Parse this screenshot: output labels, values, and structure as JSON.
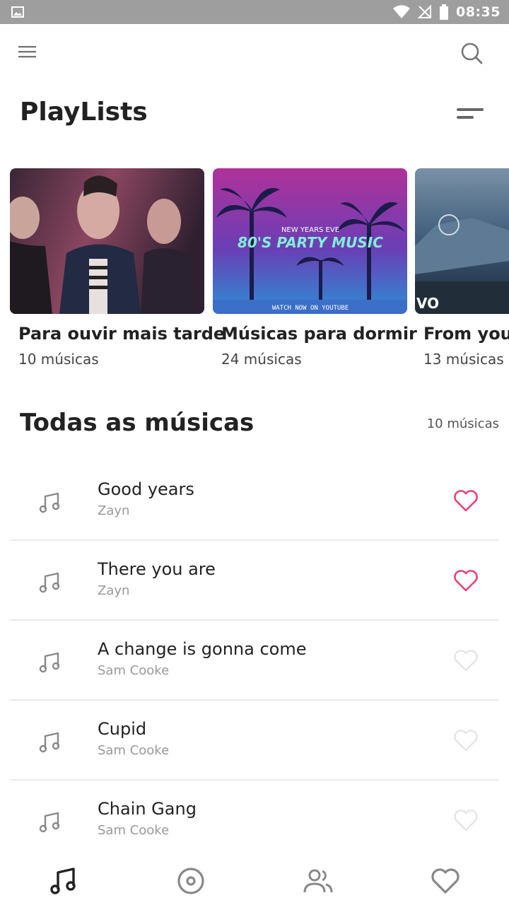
{
  "status_bar": {
    "time": "08:35",
    "icons": [
      "gallery-icon",
      "wifi-icon",
      "no-signal-icon",
      "battery-icon"
    ]
  },
  "app_bar": {
    "icons": [
      "menu-icon",
      "search-icon"
    ]
  },
  "playlists_section": {
    "title": "PlayLists",
    "sort_icon": "sort-icon",
    "items": [
      {
        "title": "Para ouvir mais tarde",
        "count": "10 músicas"
      },
      {
        "title": "Músicas para dormir",
        "count": "24 músicas",
        "art_top": "NEW YEARS EVE",
        "art_main": "80'S PARTY MUSIC",
        "art_bottom": "WATCH NOW ON YOUTUBE"
      },
      {
        "title": "From youtube",
        "count": "13 músicas",
        "art_badge": "VO"
      }
    ]
  },
  "songs_section": {
    "title": "Todas as músicas",
    "count": "10 músicas",
    "items": [
      {
        "title": "Good years",
        "artist": "Zayn",
        "favorite": true
      },
      {
        "title": "There you are",
        "artist": "Zayn",
        "favorite": true
      },
      {
        "title": "A change is gonna come",
        "artist": "Sam Cooke",
        "favorite": false
      },
      {
        "title": "Cupid",
        "artist": "Sam Cooke",
        "favorite": false
      },
      {
        "title": "Chain Gang",
        "artist": "Sam Cooke",
        "favorite": false
      }
    ]
  },
  "bottom_nav": {
    "items": [
      "music-note-icon",
      "disc-icon",
      "people-icon",
      "heart-icon"
    ],
    "active_index": 0
  },
  "colors": {
    "accent_heart": "#e8407a",
    "inactive_heart": "#e6e6e6",
    "status_bar": "#9e9e9e",
    "icon_gray": "#888888"
  }
}
